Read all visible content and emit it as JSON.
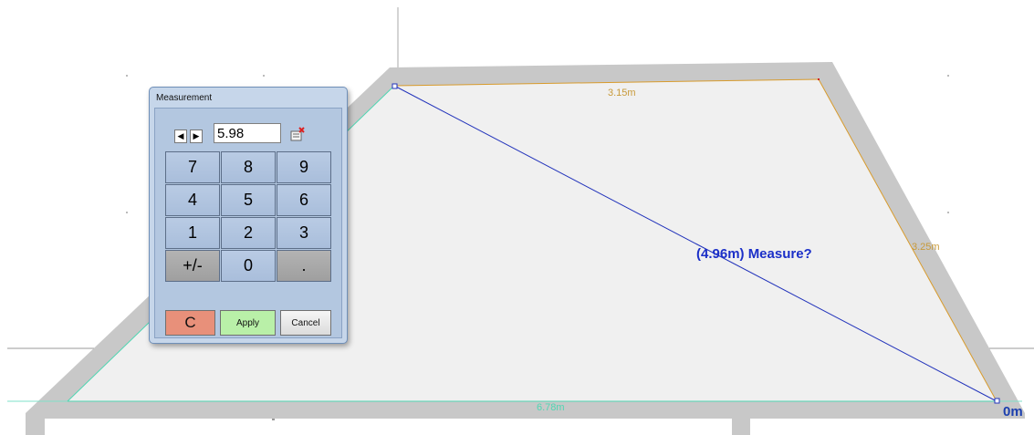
{
  "drawing": {
    "dimension_top": "3.15m",
    "dimension_right": "3.25m",
    "dimension_bottom": "6.78m",
    "measure_prompt": "(4.96m) Measure?",
    "zero_label": "0m",
    "colors": {
      "wall": "#c8c8c8",
      "floor": "#f0f0f0",
      "edge_top": "#d89b2c",
      "edge_bottom": "#4fd6b2",
      "measure_line": "#2233bb"
    }
  },
  "dialog": {
    "title": "Measurement",
    "value": "5.98",
    "keys": [
      "7",
      "8",
      "9",
      "4",
      "5",
      "6",
      "1",
      "2",
      "3",
      "+/-",
      "0",
      "."
    ],
    "clear_label": "C",
    "apply_label": "Apply",
    "cancel_label": "Cancel",
    "icons": [
      "arrow-left-icon",
      "arrow-right-icon",
      "clear-field-icon"
    ]
  }
}
